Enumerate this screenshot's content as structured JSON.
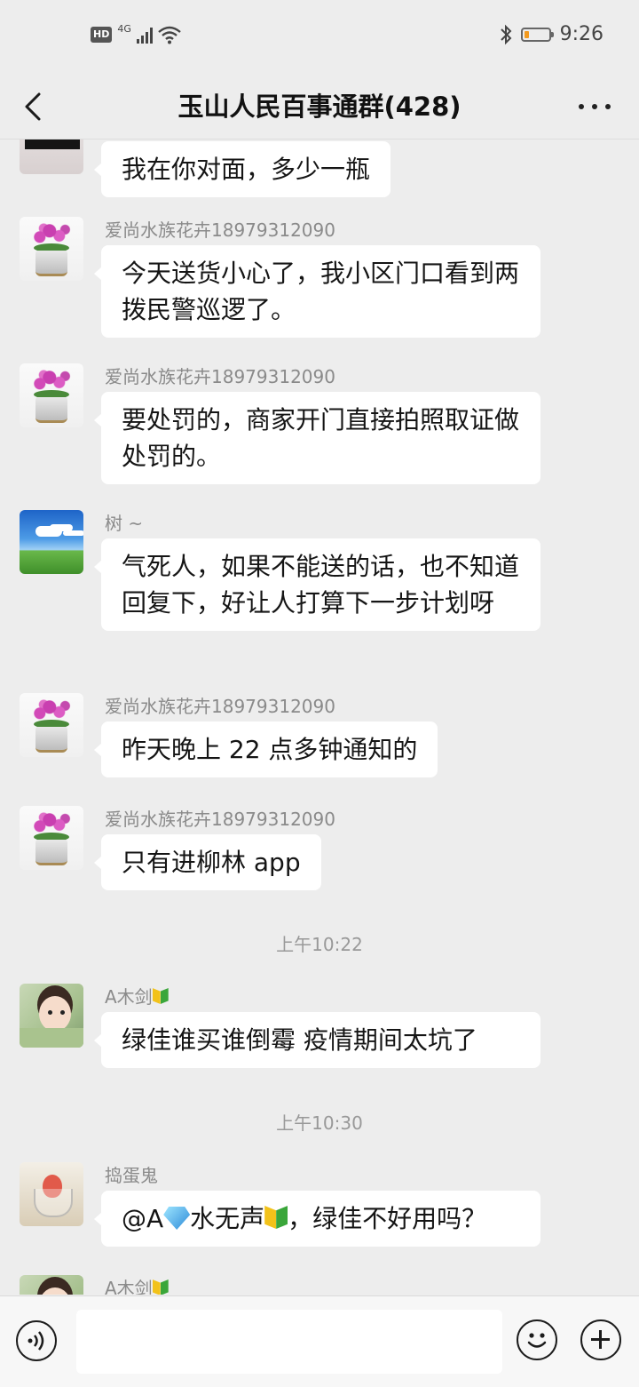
{
  "status_bar": {
    "hd_badge": "HD",
    "network": "4G",
    "bluetooth_icon": "bluetooth-icon",
    "battery_level_percent": 20,
    "battery_color": "#f39a1e",
    "time": "9:26"
  },
  "header": {
    "title": "玉山人民百事通群(428)",
    "back_icon": "chevron-left-icon",
    "more_icon": "more-dots-icon"
  },
  "messages": [
    {
      "sender": "",
      "text": "我在你对面，多少一瓶",
      "avatar": "woman-avatar"
    },
    {
      "sender": "爱尚水族花卉18979312090",
      "text": "今天送货小心了，我小区门口看到两拨民警巡逻了。",
      "avatar": "orchid-avatar"
    },
    {
      "sender": "爱尚水族花卉18979312090",
      "text": "要处罚的，商家开门直接拍照取证做处罚的。",
      "avatar": "orchid-avatar"
    },
    {
      "sender": "树 ~",
      "text": "气死人，如果不能送的话，也不知道回复下，好让人打算下一步计划呀",
      "avatar": "sky-avatar"
    },
    {
      "sender": "爱尚水族花卉18979312090",
      "text": "昨天晚上 22 点多钟通知的",
      "avatar": "orchid-avatar"
    },
    {
      "sender": "爱尚水族花卉18979312090",
      "text": "只有进柳林 app",
      "avatar": "orchid-avatar"
    },
    {
      "sender": "A木剑",
      "text": "绿佳谁买谁倒霉 疫情期间太坑了",
      "avatar": "kid-avatar"
    },
    {
      "sender": "捣蛋鬼",
      "text_prefix": "@A",
      "text_name": "水无声",
      "text_suffix": "，绿佳不好用吗？",
      "avatar": "glass-avatar"
    },
    {
      "sender": "A木剑",
      "avatar": "kid-avatar"
    }
  ],
  "timestamps": [
    "上午10:22",
    "上午10:30"
  ],
  "bottom_bar": {
    "voice_icon": "voice-icon",
    "emoji_icon": "emoji-icon",
    "plus_icon": "plus-icon",
    "input_value": ""
  }
}
